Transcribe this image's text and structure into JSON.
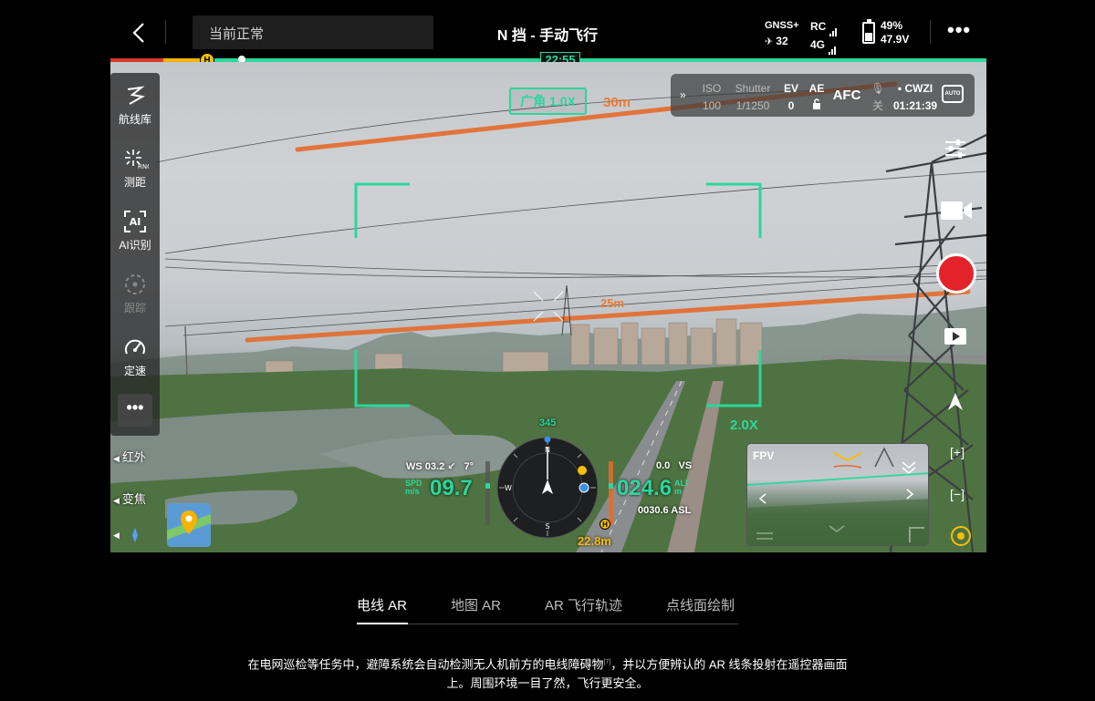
{
  "topbar": {
    "back_icon": "chevron-left-icon",
    "status_text": "当前正常",
    "mode_title": "N 挡 - 手动飞行",
    "gnss_label": "GNSS+",
    "gnss_count": "32",
    "rc_label": "RC",
    "net_label": "4G",
    "battery_percent": "49%",
    "battery_voltage": "47.9V",
    "more_icon": "more-icon",
    "more_label": "•••"
  },
  "timeline": {
    "home_marker": "H",
    "elapsed": "22:55",
    "accent": "#2bd79b"
  },
  "left_toolbar": {
    "items": [
      {
        "label": "航线库",
        "icon": "route-library-icon"
      },
      {
        "label": "测距",
        "icon": "rangefinder-icon",
        "icon_text": "RNG"
      },
      {
        "label": "AI识别",
        "icon": "ai-recognition-icon",
        "icon_text": "AI"
      },
      {
        "label": "跟踪",
        "icon": "tracking-icon"
      },
      {
        "label": "定速",
        "icon": "speed-lock-icon"
      }
    ],
    "more_label": "•••",
    "infrared_label": "红外",
    "zoom_label": "变焦"
  },
  "camera": {
    "iso_label": "ISO",
    "iso_value": "100",
    "shutter_label": "Shutter",
    "shutter_value": "1/1250",
    "ev_label": "EV",
    "ev_value": "0",
    "ae_label": "AE",
    "focus_mode": "AFC",
    "mic_state": "关",
    "storage_label": "CWZI",
    "remaining_time": "01:21:39",
    "auto_label": "AUTO"
  },
  "overlay": {
    "zoom_tag": "广角 1.0X",
    "dist_far": "30m",
    "dist_near": "25m",
    "zoom_box": "2.0X"
  },
  "telemetry": {
    "heading": "345",
    "ws_label": "WS 03.2",
    "wind_dir": "↙",
    "wind_angle": "7°",
    "spd_label_1": "SPD",
    "spd_label_2": "m/s",
    "speed": "09.7",
    "vs_value": "0.0",
    "vs_label": "VS",
    "alt_label_1": "ALT",
    "alt_label_2": "m",
    "altitude": "024.6",
    "asl": "0030.6 ASL",
    "home_dist": "22.8m",
    "compass": {
      "n": "N",
      "e": "E",
      "s": "S",
      "w": "W"
    }
  },
  "fpv": {
    "label": "FPV"
  },
  "tabs": [
    {
      "label": "电线 AR",
      "active": true
    },
    {
      "label": "地图 AR",
      "active": false
    },
    {
      "label": "AR 飞行轨迹",
      "active": false
    },
    {
      "label": "点线面绘制",
      "active": false
    }
  ],
  "description": {
    "line1": "在电网巡检等任务中，避障系统会自动检测无人机前方的电线障碍物",
    "footnote": "[7]",
    "line1_tail": "，并以方便辨认的 AR 线条投射在遥控器画面",
    "line2": "上。周围环境一目了然，飞行更安全。"
  }
}
